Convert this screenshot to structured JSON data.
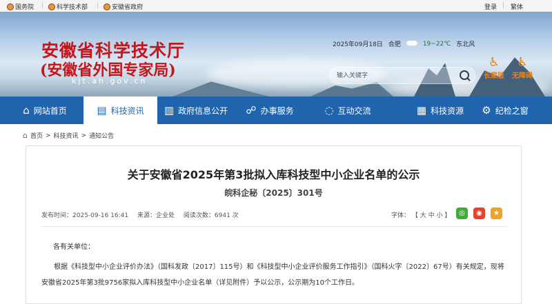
{
  "topbar": {
    "links": [
      "国务院",
      "科学技术部",
      "安徽省政府"
    ],
    "login": "登录",
    "traditional": "繁体"
  },
  "header": {
    "title_line1": "安徽省科学技术厅",
    "title_line2": "(安徽省外国专家局)",
    "domain": "kjt.ah.gov.cn",
    "date": "2025年09月18日",
    "city": "合肥",
    "temperature": "19~22℃",
    "wind": "东北风",
    "search_placeholder": "输入关键字",
    "elderly_mode": "长辈版",
    "accessibility": "无障碍"
  },
  "nav": {
    "items": [
      "网站首页",
      "科技资讯",
      "政府信息公开",
      "办事服务",
      "互动交流",
      "科技资源",
      "纪检之窗"
    ],
    "active_index": 1
  },
  "breadcrumb": [
    "首页",
    "科技资讯",
    "通知公告"
  ],
  "article": {
    "title": "关于安徽省2025年第3批拟入库科技型中小企业名单的公示",
    "doc_number": "皖科企秘〔2025〕301号",
    "publish_label": "发布时间：",
    "publish_time": "2025-09-16 16:41",
    "source_label": "来源：",
    "source": "企业处",
    "views_label": "阅读次数：",
    "views": "6941 次",
    "font_label": "字体：",
    "font_sizes": "【 大 中 小 】",
    "salutation": "各有关单位：",
    "paragraph": "根据《科技型中小企业评价办法》（国科发政〔2017〕115号）和《科技型中小企业评价服务工作指引》（国科火字〔2022〕67号）有关规定，现将安徽省2025年第3批9756家拟入库科技型中小企业名单（详见附件）予以公示，公示期为10个工作日。"
  },
  "colors": {
    "brand_red": "#c4161c",
    "nav_blue": "#1f64ad",
    "accent_orange": "#e8821b"
  }
}
